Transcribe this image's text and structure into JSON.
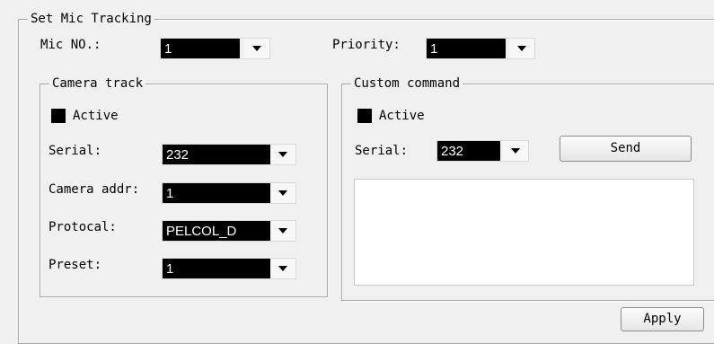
{
  "set_mic_tracking": {
    "title": "Set Mic Tracking",
    "mic_no_label": "Mic NO.:",
    "mic_no_value": "1",
    "priority_label": "Priority:",
    "priority_value": "1"
  },
  "camera_track": {
    "title": "Camera track",
    "active_label": "Active",
    "active_checked": true,
    "serial_label": "Serial:",
    "serial_value": "232",
    "camera_addr_label": "Camera addr:",
    "camera_addr_value": "1",
    "protocol_label": "Protocal:",
    "protocol_value": "PELCOL_D",
    "preset_label": "Preset:",
    "preset_value": "1"
  },
  "custom_command": {
    "title": "Custom command",
    "active_label": "Active",
    "active_checked": true,
    "serial_label": "Serial:",
    "serial_value": "232",
    "send_label": "Send",
    "command_text": ""
  },
  "apply_label": "Apply",
  "icons": {
    "dropdown": "chevron-down-icon",
    "checkbox": "checkbox-icon"
  }
}
